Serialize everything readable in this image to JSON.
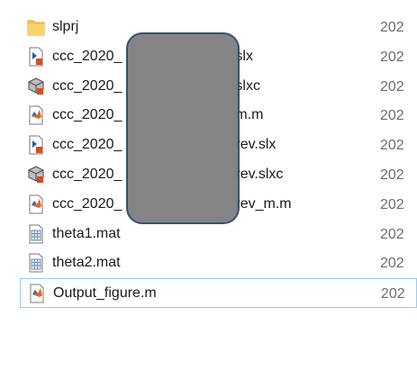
{
  "files": [
    {
      "name": "slprj",
      "date": "202",
      "icon": "folder-icon"
    },
    {
      "name": "ccc_2020_",
      "suffix": "slx",
      "date": "202",
      "icon": "simulink-model-icon"
    },
    {
      "name": "ccc_2020_",
      "suffix": "slxc",
      "date": "202",
      "icon": "simulink-cache-icon"
    },
    {
      "name": "ccc_2020_",
      "suffix": "m.m",
      "date": "202",
      "icon": "matlab-script-icon"
    },
    {
      "name": "ccc_2020_",
      "suffix": "rev.slx",
      "date": "202",
      "icon": "simulink-model-icon"
    },
    {
      "name": "ccc_2020_",
      "suffix": "rev.slxc",
      "date": "202",
      "icon": "simulink-cache-icon"
    },
    {
      "name": "ccc_2020_",
      "suffix": "rev_m.m",
      "date": "202",
      "icon": "matlab-script-icon"
    },
    {
      "name": "theta1.mat",
      "date": "202",
      "icon": "mat-file-icon"
    },
    {
      "name": "theta2.mat",
      "date": "202",
      "icon": "mat-file-icon"
    },
    {
      "name": "Output_figure.m",
      "date": "202",
      "icon": "matlab-script-icon",
      "selected": true
    }
  ],
  "colors": {
    "folder": "#f4c653",
    "selection_border": "#99c9ef",
    "redaction_fill": "#7f7f7f",
    "redaction_border": "#2e4a6e",
    "date_text": "#6d6d6d"
  }
}
